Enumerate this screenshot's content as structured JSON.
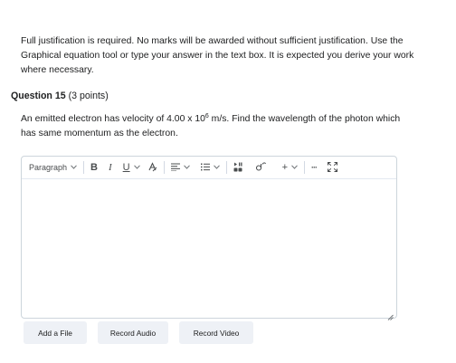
{
  "instructions": "Full justification is required. No marks will be awarded without sufficient justification. Use the Graphical equation tool or type your answer in the text box. It is expected you derive your work where necessary.",
  "question": {
    "title": "Question 15",
    "points": "(3 points)",
    "text_before": "An emitted electron has velocity of 4.00 x 10",
    "exponent": "6",
    "text_after": " m/s. Find the wavelength of the photon which has same momentum as the electron."
  },
  "editor": {
    "format_label": "Paragraph",
    "toolbar_icons": [
      "chevron-down-icon",
      "bold-icon",
      "italic-icon",
      "underline-icon",
      "text-color-icon",
      "align-icon",
      "list-icon",
      "insert-media-icon",
      "equation-icon",
      "add-icon",
      "more-icon",
      "fullscreen-icon"
    ],
    "bold_glyph": "B",
    "italic_glyph": "I",
    "underline_glyph": "U",
    "add_glyph": "+",
    "more_glyph": "···"
  },
  "buttons": {
    "add_file": "Add a File",
    "record_audio": "Record Audio",
    "record_video": "Record Video"
  },
  "colors": {
    "text": "#202122",
    "editor_border": "#cdd5dc",
    "button_bg": "#eef1f6"
  }
}
